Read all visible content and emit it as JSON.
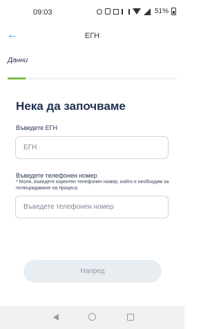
{
  "status_bar": {
    "time": "09:03",
    "battery": "51%",
    "icons": [
      "alarm-icon",
      "nfc-icon",
      "data-icon",
      "vibrate-icon",
      "wifi-icon",
      "signal-icon",
      "battery-icon"
    ]
  },
  "header": {
    "back_icon": "←",
    "title": "ЕГН"
  },
  "tabs": [
    {
      "label": "Данни",
      "active": true
    }
  ],
  "form": {
    "heading": "Нека да започваме",
    "egn": {
      "label": "Въведете ЕГН",
      "placeholder": "ЕГН"
    },
    "phone": {
      "label": "Въведете телефонен номер",
      "hint": "* Моля, въведете коректен телефонен номер, който е необходим за потвърждаване на процеса.",
      "placeholder": "Въведете телефонен номер"
    },
    "next_button": "Напред"
  },
  "colors": {
    "accent": "#7dbd47",
    "back_arrow": "#3b8fd0",
    "heading": "#22314f",
    "button_bg": "#e8edf1",
    "button_text": "#8f98a8"
  }
}
